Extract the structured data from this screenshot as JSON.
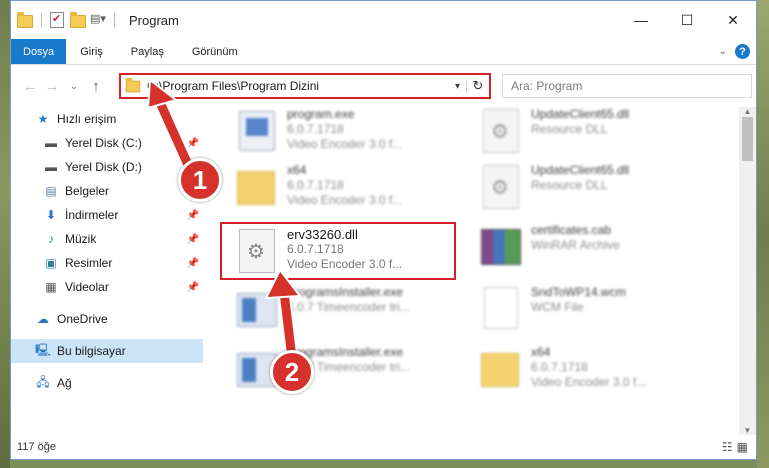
{
  "window": {
    "title": "Program",
    "minimize": "—",
    "maximize": "☐",
    "close": "✕"
  },
  "ribbon": {
    "tabs": [
      "Dosya",
      "Giriş",
      "Paylaş",
      "Görünüm"
    ],
    "help": "?"
  },
  "address": {
    "path": "C:\\Program Files\\Program Dizini",
    "search_placeholder": "Ara: Program"
  },
  "sidebar": {
    "items": [
      {
        "label": "Hızlı erişim",
        "icon": "star-icon"
      },
      {
        "label": "Yerel Disk (C:)",
        "icon": "drive-icon"
      },
      {
        "label": "Yerel Disk (D:)",
        "icon": "drive-icon"
      },
      {
        "label": "Belgeler",
        "icon": "documents-icon"
      },
      {
        "label": "İndirmeler",
        "icon": "download-icon"
      },
      {
        "label": "Müzik",
        "icon": "music-icon"
      },
      {
        "label": "Resimler",
        "icon": "pictures-icon"
      },
      {
        "label": "Videolar",
        "icon": "videos-icon"
      },
      {
        "label": "OneDrive",
        "icon": "cloud-icon"
      },
      {
        "label": "Bu bilgisayar",
        "icon": "computer-icon"
      },
      {
        "label": "Ağ",
        "icon": "network-icon"
      }
    ]
  },
  "files": [
    {
      "name": "program.exe",
      "line2": "6.0.7.1718",
      "line3": "Video Encoder 3.0 f..."
    },
    {
      "name": "UpdateClient65.dll",
      "line2": "Resource DLL",
      "line3": ""
    },
    {
      "name": "x64",
      "line2": "6.0.7.1718",
      "line3": "Video Encoder 3.0 f..."
    },
    {
      "name": "UpdateClient65.dll",
      "line2": "Resource DLL",
      "line3": ""
    },
    {
      "name": "erv33260.dll",
      "line2": "6.0.7.1718",
      "line3": "Video Encoder 3.0 f..."
    },
    {
      "name": "certificates.cab",
      "line2": "WinRAR Archive",
      "line3": ""
    },
    {
      "name": "ProgramsInstaller.exe",
      "line2": "6.0.7 Timeencoder tri...",
      "line3": ""
    },
    {
      "name": "SndToWP14.wcm",
      "line2": "WCM File",
      "line3": ""
    },
    {
      "name": "ProgramsInstaller.exe",
      "line2": "6.0.7 Timeencoder tri...",
      "line3": ""
    },
    {
      "name": "x64",
      "line2": "6.0.7.1718",
      "line3": "Video Encoder 3.0 f..."
    }
  ],
  "status": {
    "count": "117 öğe"
  },
  "callouts": {
    "one": "1",
    "two": "2"
  },
  "colors": {
    "accent": "#1979ca",
    "highlight": "#d8202a",
    "badge": "#d5322c"
  }
}
